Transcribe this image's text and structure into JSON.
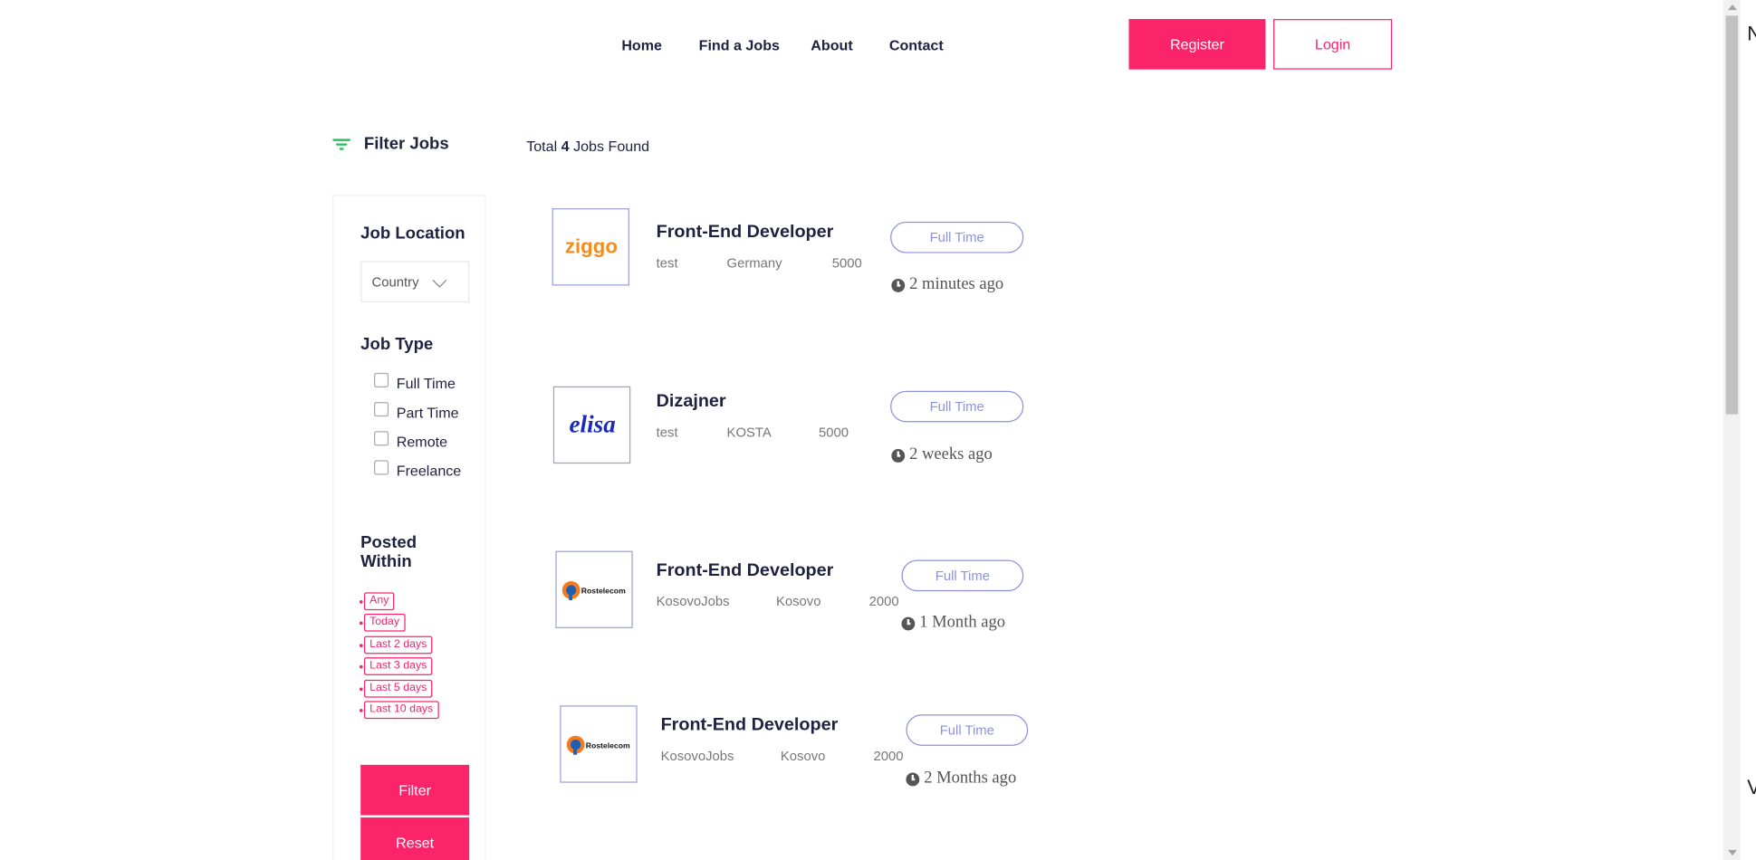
{
  "nav": {
    "home": "Home",
    "find_jobs": "Find a Jobs",
    "about": "About",
    "contact": "Contact",
    "register": "Register",
    "login": "Login"
  },
  "filter": {
    "title": "Filter Jobs",
    "total_prefix": "Total",
    "total_count": "4",
    "total_suffix": "Jobs Found",
    "location_heading": "Job Location",
    "country_select": "Country",
    "type_heading": "Job Type",
    "types": [
      "Full Time",
      "Part Time",
      "Remote",
      "Freelance"
    ],
    "posted_heading_1": "Posted",
    "posted_heading_2": "Within",
    "posted": [
      "Any",
      "Today",
      "Last 2 days",
      "Last 3 days",
      "Last 5 days",
      "Last 10 days"
    ],
    "filter_button": "Filter",
    "reset_button": "Reset"
  },
  "jobs": [
    {
      "title": "Front-End Developer",
      "company": "test",
      "location": "Germany",
      "salary": "5000",
      "type": "Full Time",
      "posted": "2 minutes ago",
      "logo": "ziggo"
    },
    {
      "title": "Dizajner",
      "company": "test",
      "location": "KOSTA",
      "salary": "5000",
      "type": "Full Time",
      "posted": "2 weeks ago",
      "logo": "elisa"
    },
    {
      "title": "Front-End Developer",
      "company": "KosovoJobs",
      "location": "Kosovo",
      "salary": "2000",
      "type": "Full Time",
      "posted": "1 Month ago",
      "logo": "rostelecom"
    },
    {
      "title": "Front-End Developer",
      "company": "KosovoJobs",
      "location": "Kosovo",
      "salary": "2000",
      "type": "Full Time",
      "posted": "2 Months ago",
      "logo": "rostelecom"
    }
  ],
  "logos": {
    "ziggo": "ziggo",
    "elisa": "elisa",
    "rostelecom": "Rostelecom"
  },
  "edge": {
    "top": "N",
    "bottom": "V"
  },
  "colors": {
    "accent": "#fb246a",
    "type_pill": "#8b92dd",
    "filter_icon": "#27c25f"
  }
}
